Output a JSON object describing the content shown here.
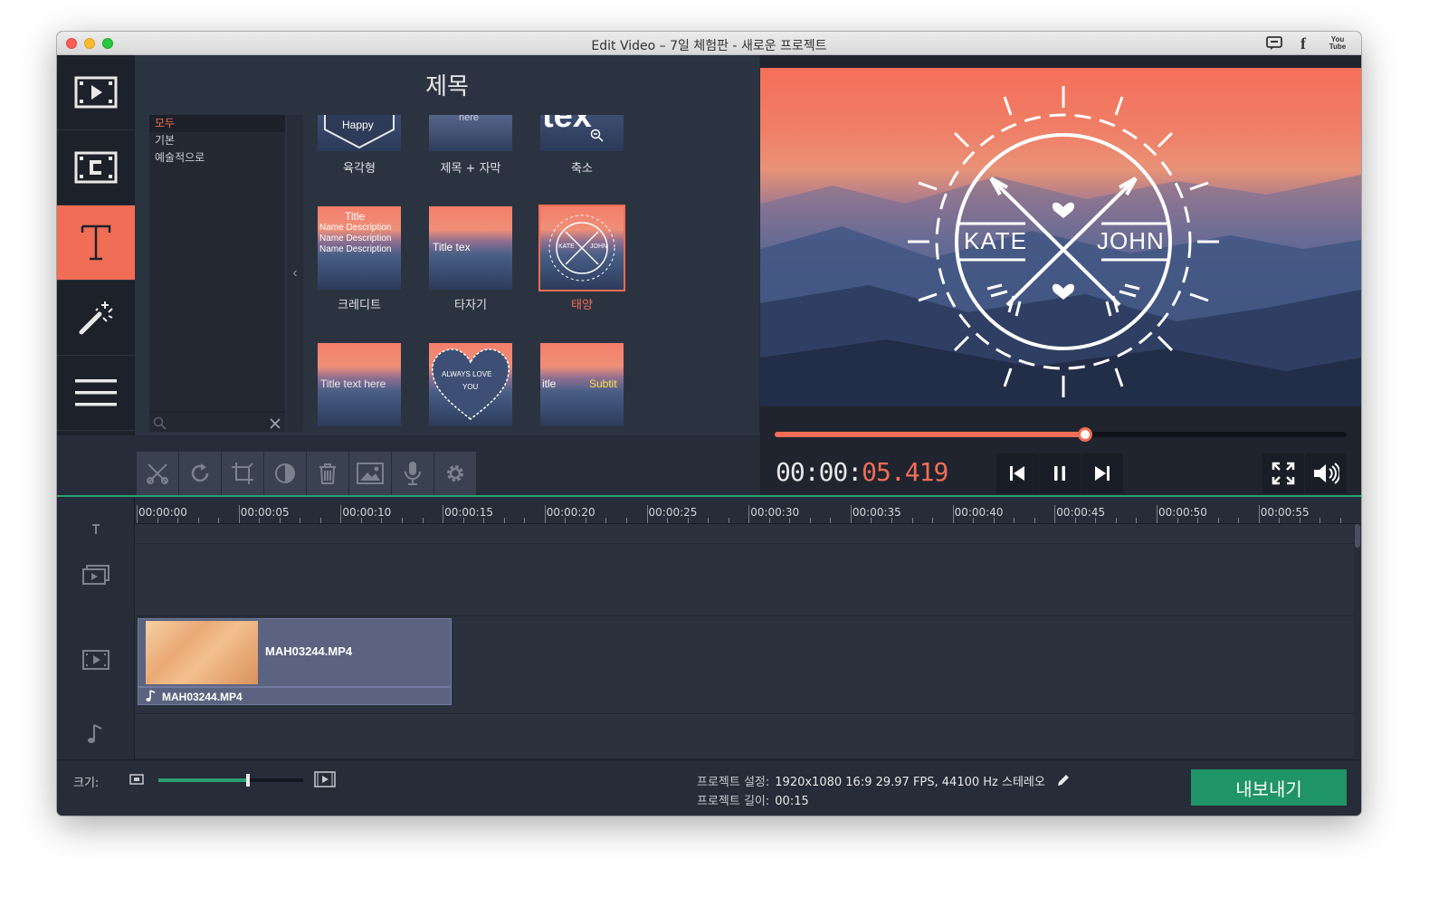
{
  "window": {
    "title": "Edit Video – 7일 체험판 - 새로운 프로젝트",
    "youtube_top": "You",
    "youtube_bottom": "Tube"
  },
  "panel": {
    "title": "제목",
    "categories": [
      "모두",
      "기본",
      "예술적으로"
    ],
    "tiles": [
      {
        "label": "육각형",
        "text": "Happy"
      },
      {
        "label": "제목 + 자막",
        "text": "here"
      },
      {
        "label": "축소",
        "text": "tex"
      },
      {
        "label": "크레디트",
        "text_title": "Title",
        "text_lines": [
          "Name Description",
          "Name Description",
          "Name Description"
        ]
      },
      {
        "label": "타자기",
        "text": "Title tex"
      },
      {
        "label": "태양",
        "text_left": "KATE",
        "text_right": "JOHN"
      },
      {
        "label": "",
        "text": "Title text here"
      },
      {
        "label": "",
        "text_top": "ALWAYS LOVE",
        "text_bottom": "YOU"
      },
      {
        "label": "",
        "text_left": "itle",
        "text_right": "Subtit"
      }
    ]
  },
  "preview": {
    "overlay_left": "KATE",
    "overlay_right": "JOHN",
    "timecode_dim": "00:00:",
    "timecode_hi": "05.419",
    "progress": 0.543
  },
  "timeline": {
    "ticks": [
      "00:00:00",
      "00:00:05",
      "00:00:10",
      "00:00:15",
      "00:00:20",
      "00:00:25",
      "00:00:30",
      "00:00:35",
      "00:00:40",
      "00:00:45",
      "00:00:50",
      "00:00:55"
    ],
    "video_clip": "MAH03244.MP4",
    "audio_clip": "MAH03244.MP4"
  },
  "bottom": {
    "size_label": "크기:",
    "zoom": 0.62,
    "settings_label": "프로젝트 설정:",
    "settings_value": "1920x1080 16:9 29.97 FPS, 44100 Hz 스테레오",
    "length_label": "프로젝트 길이:",
    "length_value": "00:15",
    "export_label": "내보내기"
  },
  "colors": {
    "accent": "#f26d55",
    "green": "#1f9466",
    "panel": "#2c3340"
  }
}
